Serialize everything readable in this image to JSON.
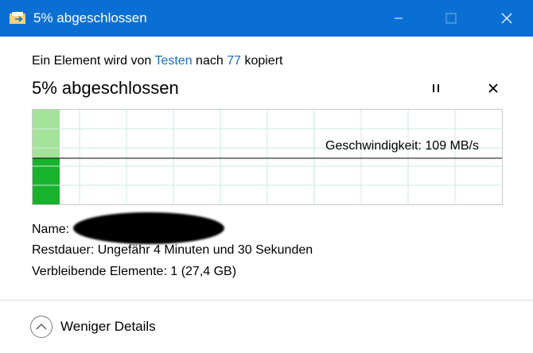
{
  "window": {
    "title": "5% abgeschlossen",
    "icon": "copy-folder-icon"
  },
  "copy": {
    "subtitle_prefix": "Ein Element wird von",
    "source": "Testen",
    "subtitle_middle": "nach",
    "destination": "77",
    "subtitle_suffix": "kopiert",
    "heading": "5% abgeschlossen",
    "progress_percent": 5
  },
  "graph": {
    "speed_label": "Geschwindigkeit: 109 MB/s",
    "colors": {
      "done": "#17b32a",
      "done_light": "#a6e39a",
      "grid": "#c9ecd9",
      "line": "#000000"
    }
  },
  "details": {
    "name_label": "Name:",
    "rest_label": "Restdauer: Ungefähr 4 Minuten und 30 Sekunden",
    "items_label": "Verbleibende Elemente: 1 (27,4 GB)"
  },
  "footer": {
    "less_details_label": "Weniger Details"
  },
  "colors": {
    "titlebar": "#0a6fd2",
    "link": "#1a6ec2"
  }
}
